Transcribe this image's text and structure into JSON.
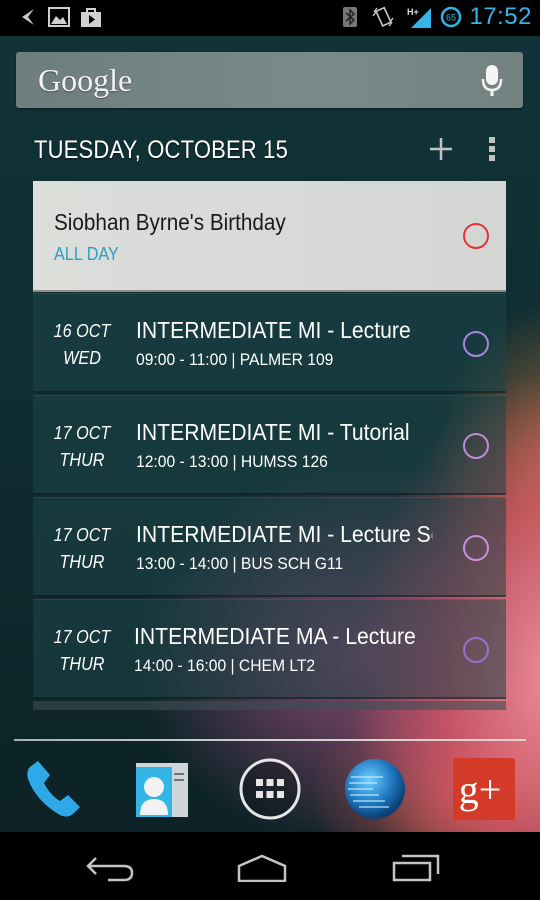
{
  "status_bar": {
    "left_icons": [
      "notification-arrow-icon",
      "gallery-icon",
      "play-store-icon"
    ],
    "right_icons": [
      "bluetooth-icon",
      "vibrate-icon",
      "signal-hplus-icon",
      "battery-circle-icon"
    ],
    "network_type": "H+",
    "battery_level": "65",
    "time": "17:52"
  },
  "search_widget": {
    "logo_text": "Google",
    "mic_icon": "microphone-icon"
  },
  "calendar_widget": {
    "date_header": "TUESDAY, OCTOBER 15",
    "add_icon": "plus-icon",
    "menu_icon": "overflow-menu-icon",
    "colors": {
      "allday_accent": "#2e9ec4",
      "birthday_circle": "#e2333a",
      "event_circle": "#a585d8"
    },
    "all_day_event": {
      "title": "Siobhan Byrne's Birthday",
      "subtitle": "ALL DAY"
    },
    "events": [
      {
        "date": "16 OCT",
        "day": "WED",
        "title": "INTERMEDIATE MI - Lecture",
        "time": "09:00 - 11:00",
        "location": "PALMER 109",
        "detail": "09:00 - 11:00  |  PALMER 109"
      },
      {
        "date": "17 OCT",
        "day": "THUR",
        "title": "INTERMEDIATE MI - Tutorial",
        "time": "12:00 - 13:00",
        "location": "HUMSS 126",
        "detail": "12:00 - 13:00  |  HUMSS 126"
      },
      {
        "date": "17 OCT",
        "day": "THUR",
        "title": "INTERMEDIATE MI - Lecture Series",
        "time": "13:00 - 14:00",
        "location": "BUS SCH G11",
        "detail": "13:00 - 14:00  |  BUS SCH G11"
      },
      {
        "date": "17 OCT",
        "day": "THUR",
        "title": "INTERMEDIATE MA - Lecture",
        "time": "14:00 - 16:00",
        "location": "CHEM LT2",
        "detail": "14:00 - 16:00  |  CHEM LT2"
      }
    ]
  },
  "dock": {
    "apps": [
      {
        "name": "Phone",
        "icon": "phone-icon"
      },
      {
        "name": "People",
        "icon": "contacts-icon"
      },
      {
        "name": "Apps",
        "icon": "app-drawer-icon"
      },
      {
        "name": "Browser",
        "icon": "globe-icon"
      },
      {
        "name": "Google+",
        "icon": "google-plus-icon",
        "label": "g+"
      }
    ]
  },
  "nav_bar": {
    "buttons": [
      "back-icon",
      "home-icon",
      "recents-icon"
    ]
  }
}
